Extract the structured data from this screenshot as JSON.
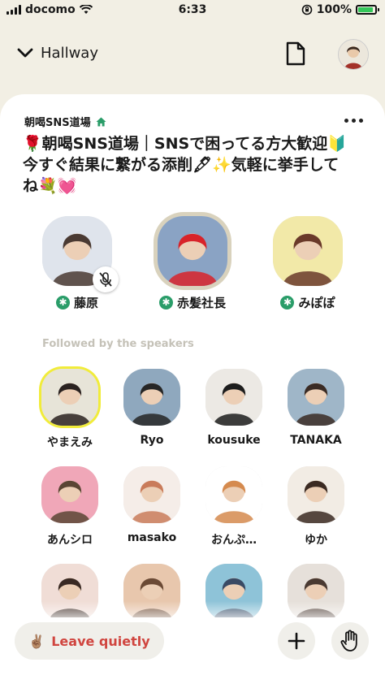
{
  "status": {
    "carrier": "docomo",
    "time": "6:33",
    "battery_text": "100%",
    "battery_level": 1.0
  },
  "topbar": {
    "back_label": "Hallway",
    "icons": [
      "chevron-down-icon",
      "document-icon"
    ]
  },
  "room": {
    "club_name": "朝喝SNS道場",
    "title": "🌹朝喝SNS道場｜SNSで困ってる方大歓迎🔰今すぐ結果に繋がる添削🖋✨気軽に挙手してね💐💓"
  },
  "speakers": [
    {
      "name": "藤原",
      "moderator": true,
      "muted": true,
      "bg": "#dfe4ec",
      "accent": "#4a3a33"
    },
    {
      "name": "赤髪社長",
      "moderator": true,
      "muted": false,
      "active": true,
      "bg": "#8aa3c4",
      "accent": "#d8232a"
    },
    {
      "name": "みぽぽ",
      "moderator": true,
      "muted": false,
      "bg": "#f2e9a8",
      "accent": "#6a3a2a"
    }
  ],
  "section_label": "Followed by the speakers",
  "listeners": [
    {
      "name": "やまえみ",
      "bg": "#e7e4d8",
      "accent": "#2a2220",
      "ring": true
    },
    {
      "name": "Ryo",
      "bg": "#8fa8be",
      "accent": "#262626"
    },
    {
      "name": "kousuke",
      "bg": "#ece9e4",
      "accent": "#1d1d1d"
    },
    {
      "name": "TANAKA",
      "bg": "#9fb6c8",
      "accent": "#3a2b24"
    },
    {
      "name": "あんシロ",
      "bg": "#f0a7b8",
      "accent": "#5a4534"
    },
    {
      "name": "masako",
      "bg": "#f5ede8",
      "accent": "#c97b5a"
    },
    {
      "name": "おんぷ…",
      "bg": "#ffffff",
      "accent": "#d58a4e"
    },
    {
      "name": "ゆか",
      "bg": "#f2ece4",
      "accent": "#3b2a22"
    },
    {
      "name": "",
      "bg": "#f0ddd6",
      "accent": "#3a2a23"
    },
    {
      "name": "",
      "bg": "#e8c7ad",
      "accent": "#6b4a35"
    },
    {
      "name": "",
      "bg": "#8ec3d8",
      "accent": "#3a4a64"
    },
    {
      "name": "",
      "bg": "#e6e0da",
      "accent": "#4a3a32"
    }
  ],
  "bottombar": {
    "leave_label": "Leave quietly",
    "leave_emoji": "✌🏽"
  }
}
